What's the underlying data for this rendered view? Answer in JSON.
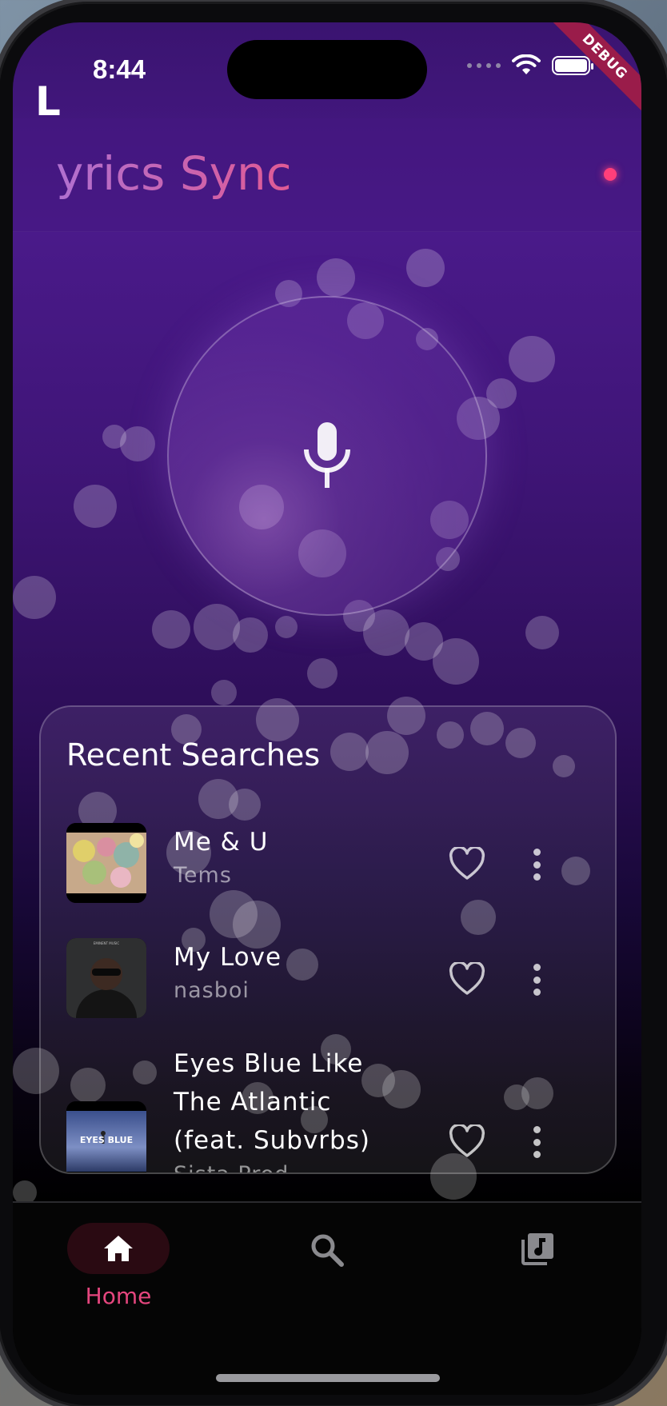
{
  "status_bar": {
    "time": "8:44",
    "debug_banner": "DEBUG"
  },
  "app": {
    "leading_letter": "L",
    "title": "yrics Sync",
    "accent_color": "#e05a94",
    "status_dot_color": "#ff3f7a"
  },
  "mic": {
    "icon": "microphone-icon"
  },
  "recent": {
    "title": "Recent Searches",
    "items": [
      {
        "title": "Me & U",
        "artist": "Tems"
      },
      {
        "title": "My Love",
        "artist": "nasboi"
      },
      {
        "title_lines": [
          "Eyes Blue Like",
          "The Atlantic",
          "(feat. Subvrbs)"
        ],
        "artist": "Sista Prod",
        "thumb_text": "EYES BLUE"
      }
    ],
    "item2_thumb_caption": "EMINENT MUSIC"
  },
  "nav": {
    "items": [
      {
        "label": "Home",
        "icon": "home-icon",
        "active": true
      },
      {
        "label": "",
        "icon": "search-icon",
        "active": false
      },
      {
        "label": "",
        "icon": "library-music-icon",
        "active": false
      }
    ]
  }
}
